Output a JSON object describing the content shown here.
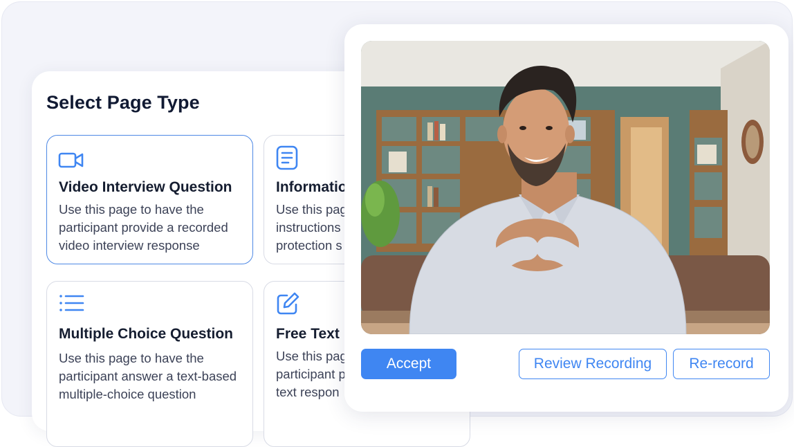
{
  "select_page": {
    "title": "Select Page Type",
    "cards": [
      {
        "icon": "video-camera-icon",
        "title": "Video Interview Question",
        "desc": "Use this page to have the participant provide a recorded video interview response",
        "selected": true
      },
      {
        "icon": "document-icon",
        "title": "Informatio",
        "desc": "Use this pag instructions protection s",
        "selected": false
      },
      {
        "icon": "list-icon",
        "title": "Multiple Choice Question",
        "desc": "Use this page to have the participant answer a text-based multiple-choice question",
        "selected": false
      },
      {
        "icon": "edit-icon",
        "title": "Free Text",
        "desc": "Use this pag participant p text respon",
        "selected": false
      }
    ]
  },
  "video": {
    "subject": "person-smiling-webcam"
  },
  "actions": {
    "accept": "Accept",
    "review": "Review Recording",
    "rerecord": "Re-record"
  },
  "colors": {
    "accent": "#3f86f2",
    "selected_border": "#4d88e5",
    "card_border": "#d8dbe5",
    "backdrop": "#f3f4fa",
    "title": "#111a33"
  }
}
